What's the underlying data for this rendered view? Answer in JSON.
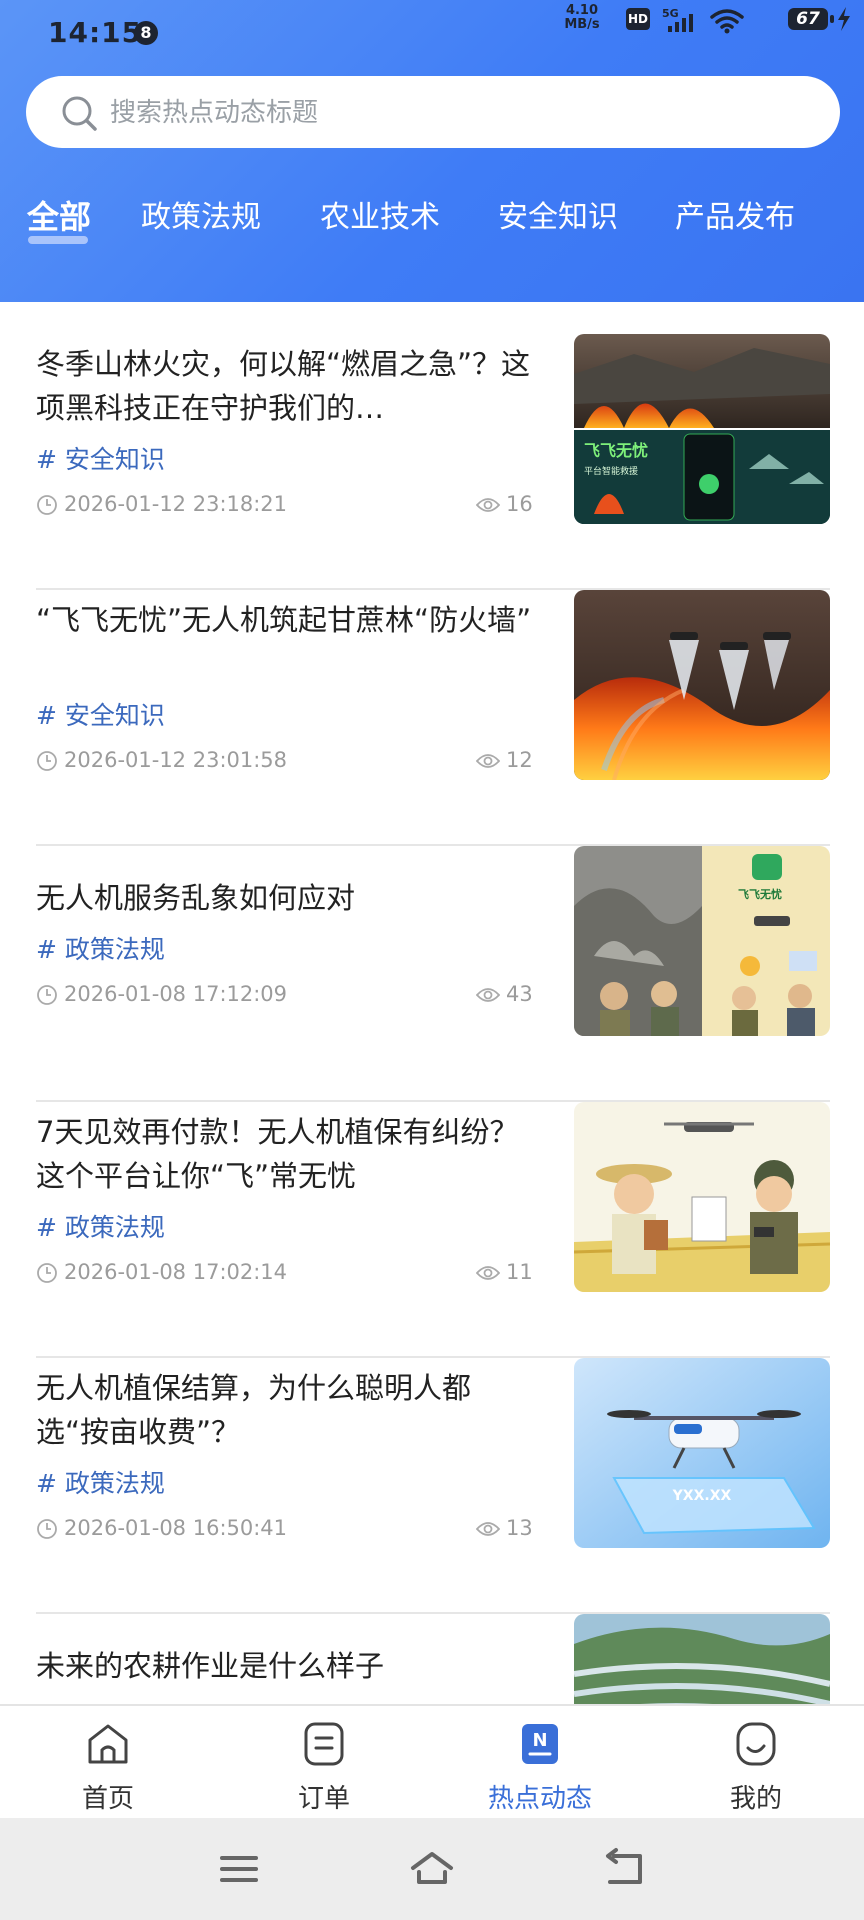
{
  "status_bar": {
    "time": "14:15",
    "notification_count": "8",
    "net_speed_value": "4.10",
    "net_speed_unit": "MB/s",
    "hd_label": "HD",
    "network_label": "5G",
    "battery_level": "67"
  },
  "search": {
    "placeholder": "搜索热点动态标题"
  },
  "tabs": [
    {
      "label": "全部",
      "active": true
    },
    {
      "label": "政策法规",
      "active": false
    },
    {
      "label": "农业技术",
      "active": false
    },
    {
      "label": "安全知识",
      "active": false
    },
    {
      "label": "产品发布",
      "active": false
    }
  ],
  "articles": [
    {
      "title": "冬季山林火灾，何以解“燃眉之急”？这项黑科技正在守护我们的…",
      "tag": "# 安全知识",
      "time": "2026-01-12 23:18:21",
      "views": "16",
      "thumb_caption": "飞飞无忧",
      "thumb_subcaption": "平台智能救援"
    },
    {
      "title": "“飞飞无忧”无人机筑起甘蔗林“防火墙”",
      "tag": "# 安全知识",
      "time": "2026-01-12 23:01:58",
      "views": "12"
    },
    {
      "title": "无人机服务乱象如何应对",
      "tag": "# 政策法规",
      "time": "2026-01-08 17:12:09",
      "views": "43",
      "thumb_caption": "飞飞无忧"
    },
    {
      "title": "7天见效再付款！无人机植保有纠纷？这个平台让你“飞”常无忧",
      "tag": "# 政策法规",
      "time": "2026-01-08 17:02:14",
      "views": "11"
    },
    {
      "title": "无人机植保结算，为什么聪明人都选“按亩收费”？",
      "tag": "# 政策法规",
      "time": "2026-01-08 16:50:41",
      "views": "13",
      "thumb_caption": "YXX.XX"
    },
    {
      "title": "未来的农耕作业是什么样子",
      "tag": "",
      "time": "",
      "views": ""
    }
  ],
  "bottom_nav": [
    {
      "label": "首页",
      "icon": "home-icon",
      "active": false
    },
    {
      "label": "订单",
      "icon": "order-icon",
      "active": false
    },
    {
      "label": "热点动态",
      "icon": "news-icon",
      "active": true
    },
    {
      "label": "我的",
      "icon": "profile-icon",
      "active": false
    }
  ],
  "colors": {
    "header_gradient_start": "#5b95f7",
    "header_gradient_end": "#3a74f1",
    "tag_color": "#3b69bd",
    "active_nav": "#3a6fd8",
    "meta_text": "#9b9b9b"
  }
}
